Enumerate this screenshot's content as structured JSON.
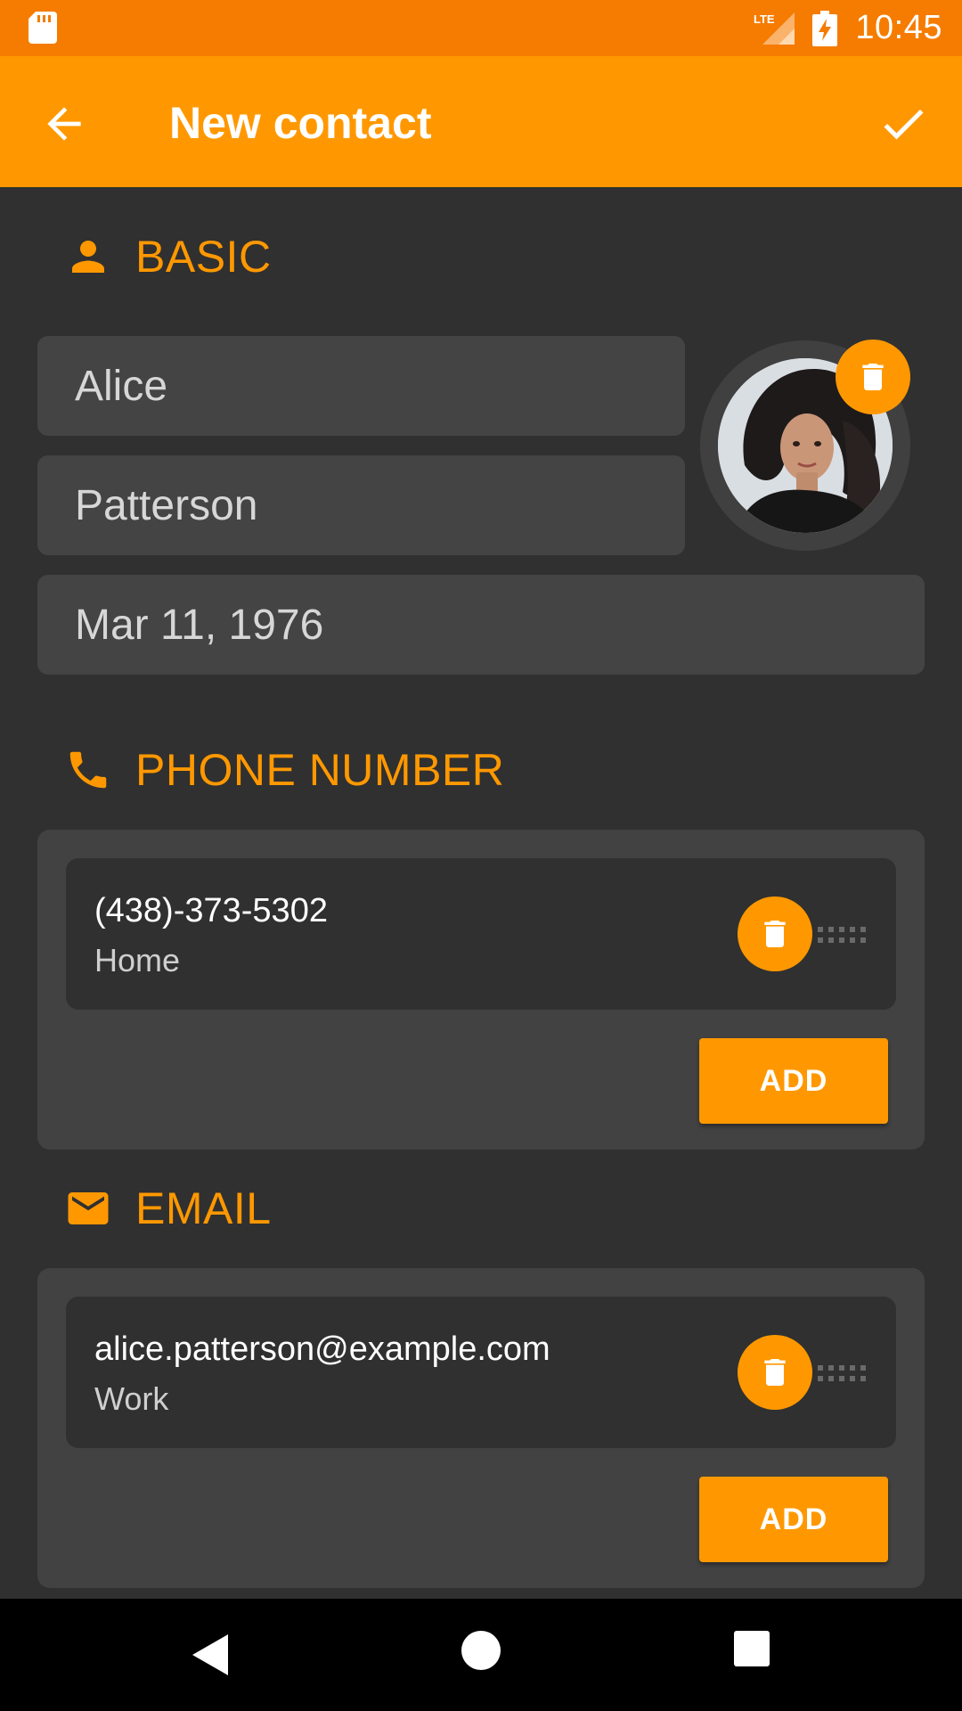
{
  "status_bar": {
    "time": "10:45",
    "network": "LTE",
    "icons": [
      "sd-card-icon",
      "lte-signal-icon",
      "battery-charging-icon"
    ]
  },
  "app_bar": {
    "title": "New contact",
    "back_icon": "arrow-back-icon",
    "save_icon": "check-icon"
  },
  "basic": {
    "title": "BASIC",
    "icon": "person-icon",
    "first_name": "Alice",
    "last_name": "Patterson",
    "birthday": "Mar 11, 1976",
    "photo_delete_icon": "trash-icon"
  },
  "phone": {
    "title": "PHONE NUMBER",
    "icon": "phone-icon",
    "entries": [
      {
        "value": "(438)-373-5302",
        "type": "Home"
      }
    ],
    "add_label": "ADD"
  },
  "email": {
    "title": "EMAIL",
    "icon": "mail-icon",
    "entries": [
      {
        "value": "alice.patterson@example.com",
        "type": "Work"
      }
    ],
    "add_label": "ADD"
  },
  "colors": {
    "accent": "#ff9800",
    "status_bar": "#f57c00",
    "background": "#303030",
    "field": "#444444"
  }
}
